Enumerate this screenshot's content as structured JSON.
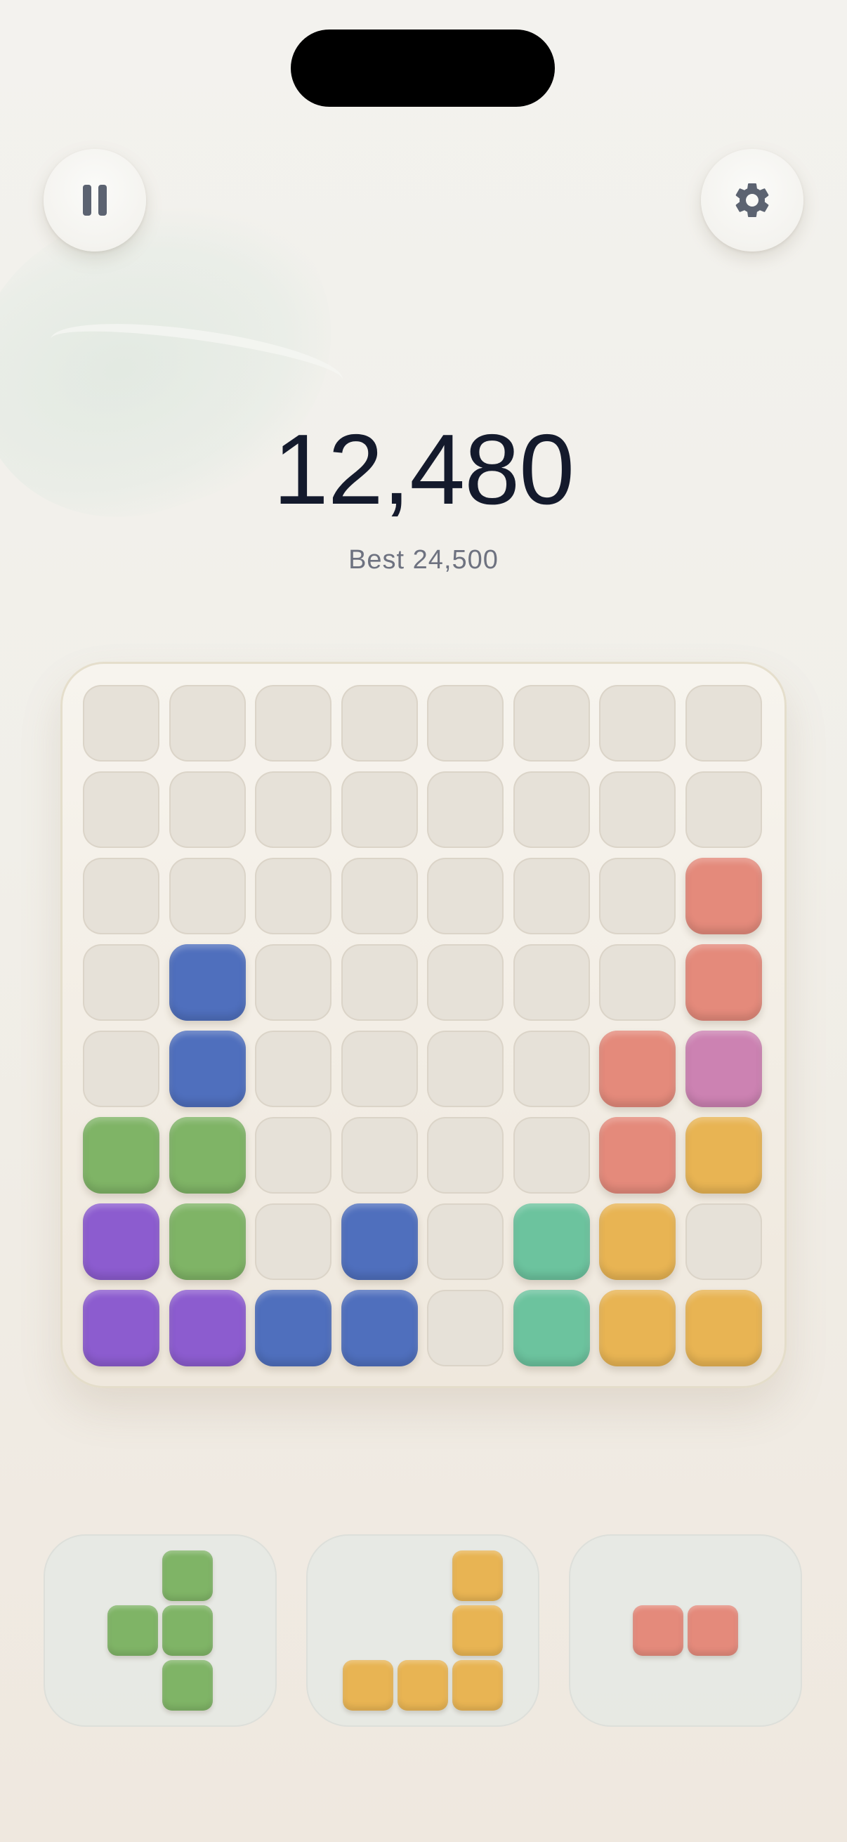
{
  "score": "12,480",
  "best": "Best 24,500",
  "icons": {
    "pause": "pause-icon",
    "settings": "gear-icon"
  },
  "colors": {
    "red": "#e48a7b",
    "blue": "#4f6fbd",
    "green": "#7fb466",
    "purple": "#8c5ccf",
    "teal": "#6cc39e",
    "yellow": "#e8b453",
    "pink": "#cc82b2",
    "empty": "#e6e1d8"
  },
  "board": [
    [
      "",
      "",
      "",
      "",
      "",
      "",
      "",
      ""
    ],
    [
      "",
      "",
      "",
      "",
      "",
      "",
      "",
      ""
    ],
    [
      "",
      "",
      "",
      "",
      "",
      "",
      "",
      "red"
    ],
    [
      "",
      "blue",
      "",
      "",
      "",
      "",
      "",
      "red"
    ],
    [
      "",
      "blue",
      "",
      "",
      "",
      "",
      "red",
      "pink"
    ],
    [
      "green",
      "green",
      "",
      "",
      "",
      "",
      "red",
      "yellow"
    ],
    [
      "purple",
      "green",
      "",
      "blue",
      "",
      "teal",
      "yellow",
      ""
    ],
    [
      "purple",
      "purple",
      "blue",
      "blue",
      "",
      "teal",
      "yellow",
      "yellow"
    ]
  ],
  "pieces": [
    {
      "color": "green",
      "cells": [
        [
          0,
          1
        ],
        [
          1,
          0
        ],
        [
          1,
          1
        ],
        [
          2,
          1
        ]
      ]
    },
    {
      "color": "yellow",
      "cells": [
        [
          0,
          2
        ],
        [
          1,
          2
        ],
        [
          2,
          0
        ],
        [
          2,
          1
        ],
        [
          2,
          2
        ]
      ]
    },
    {
      "color": "red",
      "cells": [
        [
          0,
          0
        ],
        [
          0,
          1
        ]
      ]
    }
  ]
}
